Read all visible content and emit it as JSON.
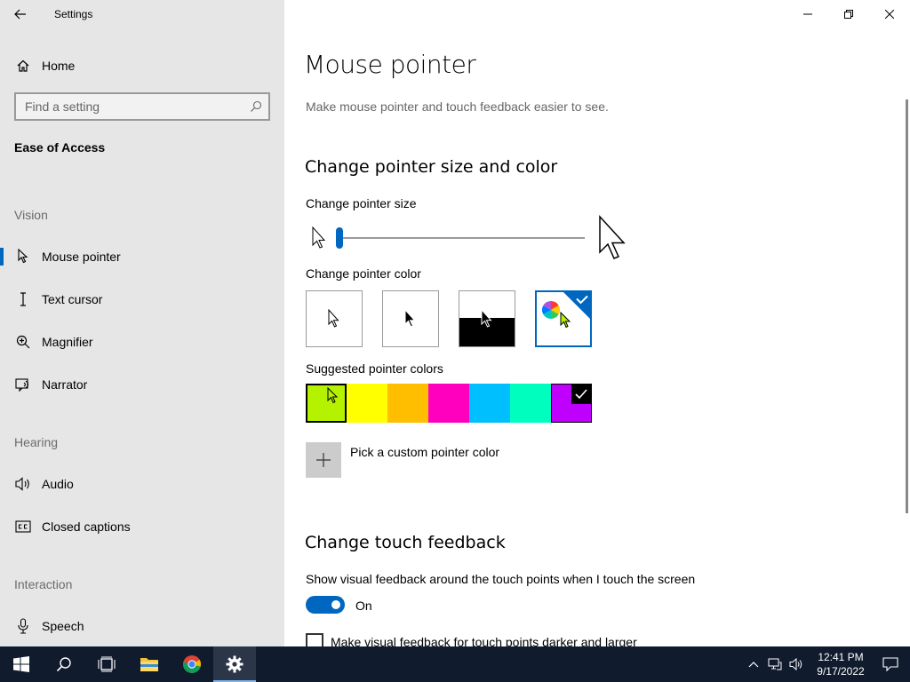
{
  "window": {
    "title": "Settings"
  },
  "sidebar": {
    "home_label": "Home",
    "search_placeholder": "Find a setting",
    "section_title": "Ease of Access",
    "groups": {
      "vision": "Vision",
      "hearing": "Hearing",
      "interaction": "Interaction"
    },
    "items": [
      {
        "label": "Mouse pointer",
        "icon": "mouse-pointer-icon",
        "active": true
      },
      {
        "label": "Text cursor",
        "icon": "text-cursor-icon"
      },
      {
        "label": "Magnifier",
        "icon": "magnifier-icon"
      },
      {
        "label": "Narrator",
        "icon": "narrator-icon"
      },
      {
        "label": "Audio",
        "icon": "speaker-icon"
      },
      {
        "label": "Closed captions",
        "icon": "closed-captions-icon"
      },
      {
        "label": "Speech",
        "icon": "microphone-icon"
      }
    ]
  },
  "main": {
    "title": "Mouse pointer",
    "description": "Make mouse pointer and touch feedback easier to see.",
    "size_color_heading": "Change pointer size and color",
    "size_label": "Change pointer size",
    "size_value_fraction": 0.0,
    "color_label": "Change pointer color",
    "color_options": [
      "white",
      "black",
      "inverted",
      "custom"
    ],
    "color_selected": "custom",
    "suggested_label": "Suggested pointer colors",
    "suggested_colors": [
      "#b5f200",
      "#ffff00",
      "#ffbf00",
      "#ff00bf",
      "#00bfff",
      "#00ffbf",
      "#bf00ff"
    ],
    "suggested_selected": "#b5f200",
    "custom_label": "Pick a custom pointer color",
    "touch_heading": "Change touch feedback",
    "touch_desc": "Show visual feedback around the touch points when I touch the screen",
    "toggle_state": "On",
    "darker_label": "Make visual feedback for touch points darker and larger"
  },
  "taskbar": {
    "time": "12:41 PM",
    "date": "9/17/2022",
    "apps": [
      "start-icon",
      "search-icon",
      "task-view-icon",
      "file-explorer-icon",
      "chrome-icon",
      "settings-icon"
    ]
  },
  "colors": {
    "accent": "#0067c0",
    "sidebar_bg": "#e6e6e6",
    "taskbar_bg": "#101b2e"
  }
}
